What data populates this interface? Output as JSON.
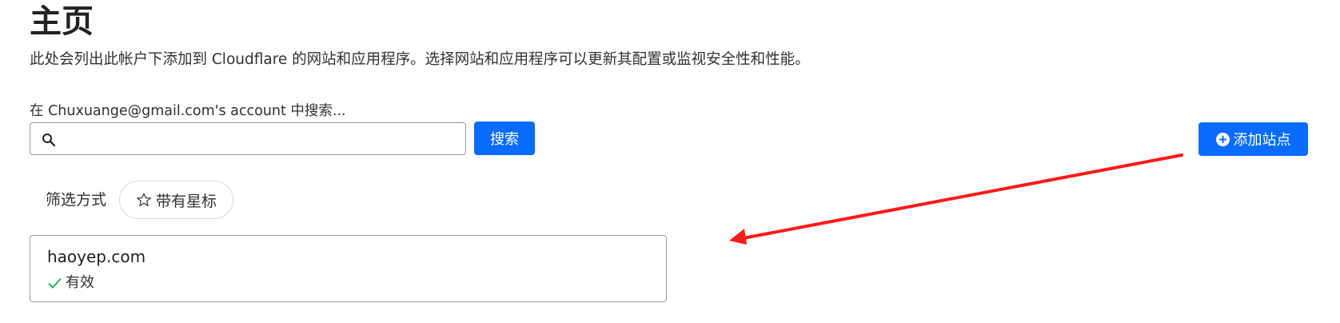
{
  "header": {
    "title": "主页",
    "description": "此处会列出此帐户下添加到 Cloudflare 的网站和应用程序。选择网站和应用程序可以更新其配置或监视安全性和性能。"
  },
  "search": {
    "label": "在 Chuxuange@gmail.com's account 中搜索...",
    "value": "",
    "placeholder": "",
    "button_label": "搜索"
  },
  "actions": {
    "add_site_label": "添加站点"
  },
  "filter": {
    "label": "筛选方式",
    "starred_label": "带有星标"
  },
  "sites": [
    {
      "name": "haoyep.com",
      "status": "有效"
    }
  ],
  "colors": {
    "primary": "#0a6cff",
    "success": "#2db35d",
    "annotation": "#ff1a1a"
  },
  "icons": {
    "search": "search-icon",
    "add": "plus-circle-icon",
    "star": "star-outline-icon",
    "status": "check-icon"
  }
}
